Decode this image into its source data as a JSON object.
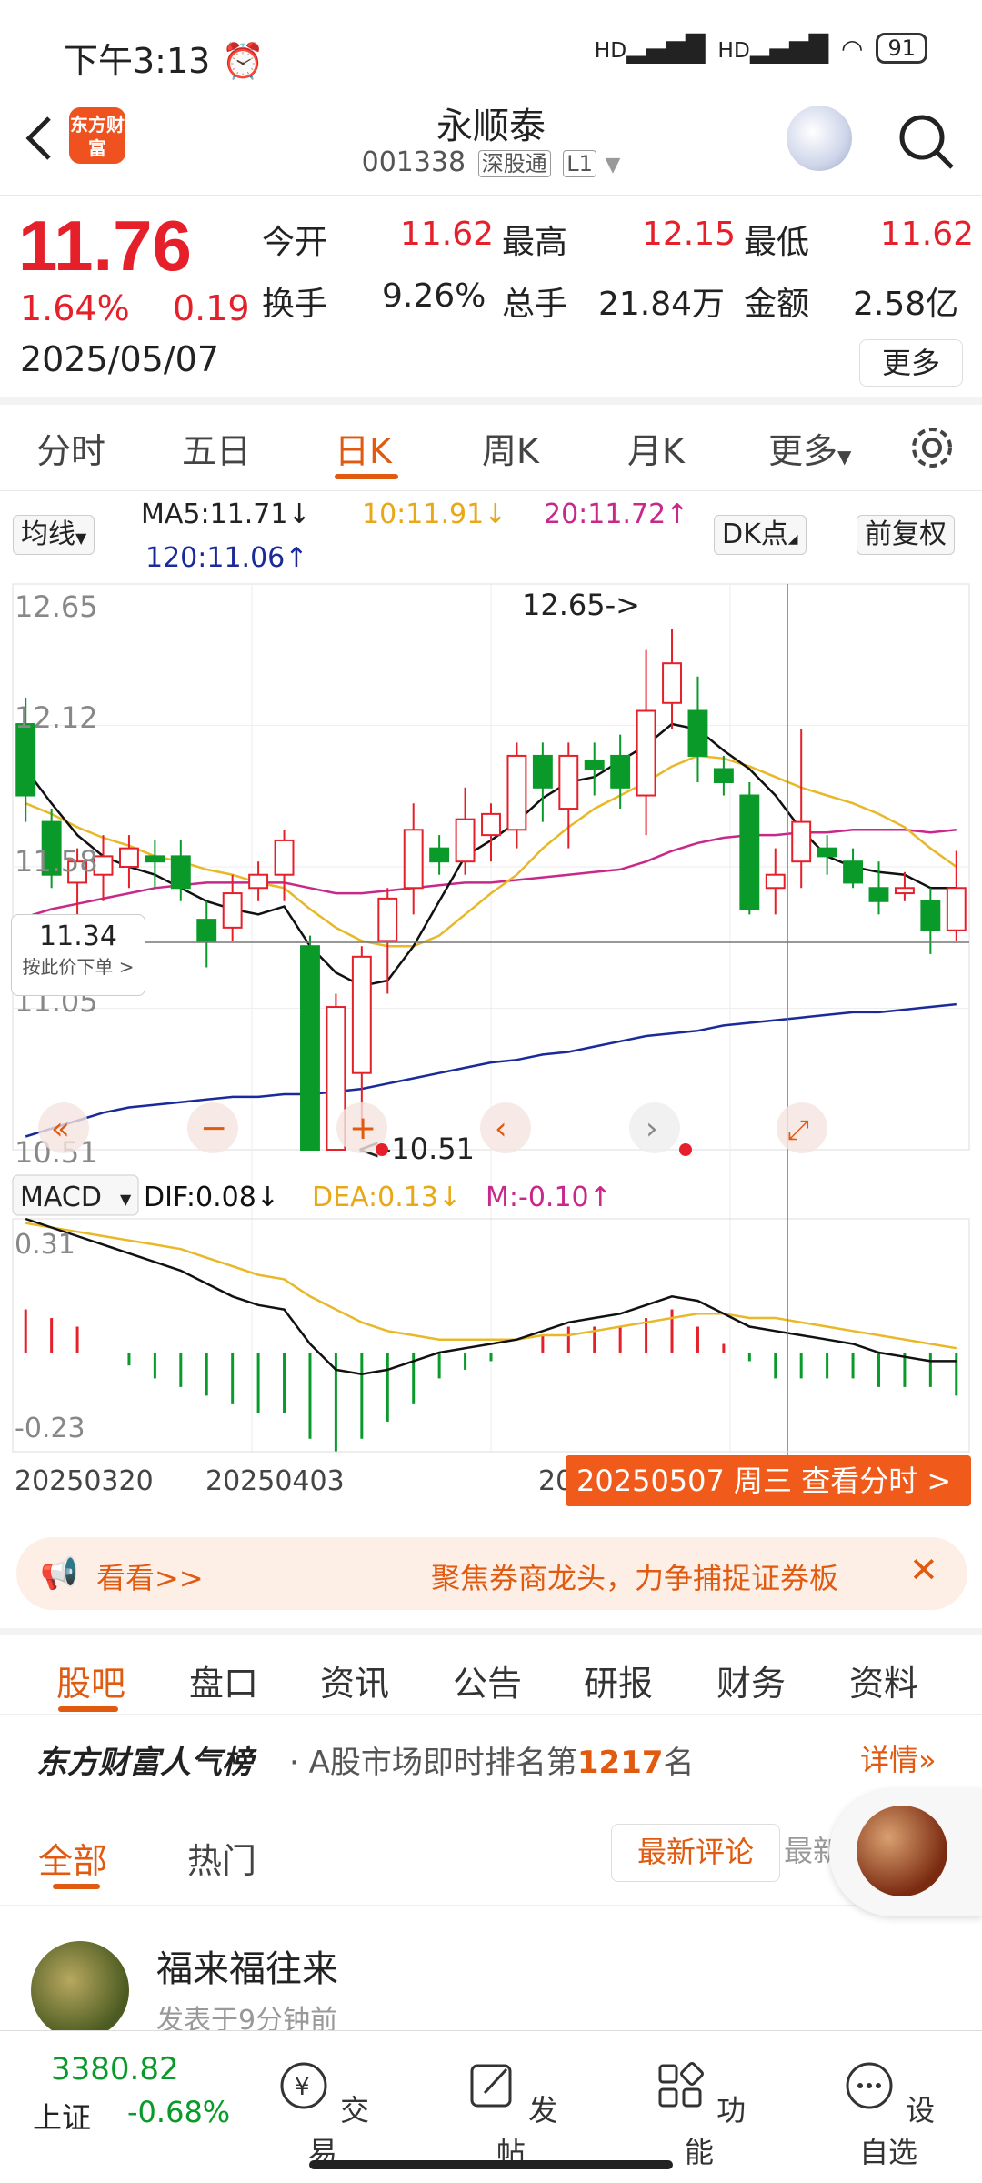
{
  "status_bar": {
    "time": "下午3:13",
    "alarm_icon": "alarm-icon",
    "network_1": "HD",
    "network_2": "HD",
    "battery": "91"
  },
  "header": {
    "logo_text": "东方财富",
    "stock_name": "永顺泰",
    "stock_code": "001338",
    "tag_1": "深股通",
    "tag_2": "L1"
  },
  "quote": {
    "price": "11.76",
    "change_pct": "1.64%",
    "change": "0.19",
    "date": "2025/05/07",
    "open_label": "今开",
    "open": "11.62",
    "high_label": "最高",
    "high": "12.15",
    "low_label": "最低",
    "low": "11.62",
    "turnover_label": "换手",
    "turnover": "9.26%",
    "volume_label": "总手",
    "volume": "21.84万",
    "amount_label": "金额",
    "amount": "2.58亿",
    "more": "更多"
  },
  "period_tabs": [
    "分时",
    "五日",
    "日K",
    "周K",
    "月K",
    "更多"
  ],
  "active_period": "日K",
  "legend": {
    "ma_button": "均线",
    "ma5": "MA5:11.71↓",
    "ma10": "10:11.91↓",
    "ma20": "20:11.72↑",
    "ma120": "120:11.06↑",
    "dk_button": "DK点",
    "adjust_button": "前复权"
  },
  "price_axis": {
    "top": "12.65",
    "l2": "12.12",
    "l3": "11.58",
    "l4": "11.05",
    "bottom": "10.51"
  },
  "annotations": {
    "high_marker": "12.65->",
    "low_marker": "<-10.51"
  },
  "price_tag": {
    "value": "11.34",
    "sub": "按此价下单 >"
  },
  "macd_legend": {
    "button": "MACD",
    "dif": "DIF:0.08↓",
    "dea": "DEA:0.13↓",
    "m": "M:-0.10↑"
  },
  "macd_axis": {
    "top": "0.31",
    "bottom": "-0.23"
  },
  "x_axis": {
    "d1": "20250320",
    "d2": "20250403",
    "d3": "20"
  },
  "view_time_btn": "20250507 周三 查看分时 >",
  "banner": {
    "left": "看看>>",
    "text": "聚焦券商龙头，力争捕捉证券板"
  },
  "content_tabs": [
    "股吧",
    "盘口",
    "资讯",
    "公告",
    "研报",
    "财务",
    "资料"
  ],
  "rank": {
    "brand": "东方财富人气榜",
    "prefix": "· A股市场即时排名第",
    "rank_no": "1217",
    "suffix": "名",
    "detail": "详情"
  },
  "sub_tabs": {
    "all": "全部",
    "hot": "热门",
    "latest": "最新评论",
    "latest2": "最新"
  },
  "post": {
    "user": "福来福往来",
    "time": "发表于9分钟前"
  },
  "bottom_nav": {
    "index_value": "3380.82",
    "index_name": "上证",
    "index_change": "-0.68%",
    "trade": "交易",
    "post": "发帖",
    "func": "功能",
    "watch": "设自选"
  },
  "colors": {
    "up": "#e5202a",
    "down": "#0a9a2a",
    "accent": "#e05a10",
    "ma5": "#111111",
    "ma10": "#e8b828",
    "ma20": "#c8288a",
    "ma120": "#1a2a9a"
  },
  "chart_data": {
    "type": "candlestick",
    "y_range": [
      10.51,
      12.65
    ],
    "candles": [
      {
        "o": 12.12,
        "c": 11.85,
        "h": 12.22,
        "l": 11.75
      },
      {
        "o": 11.75,
        "c": 11.55,
        "h": 11.8,
        "l": 11.5
      },
      {
        "o": 11.52,
        "c": 11.6,
        "h": 11.65,
        "l": 11.4
      },
      {
        "o": 11.55,
        "c": 11.62,
        "h": 11.7,
        "l": 11.45
      },
      {
        "o": 11.58,
        "c": 11.65,
        "h": 11.7,
        "l": 11.5
      },
      {
        "o": 11.62,
        "c": 11.6,
        "h": 11.68,
        "l": 11.5
      },
      {
        "o": 11.62,
        "c": 11.5,
        "h": 11.68,
        "l": 11.45
      },
      {
        "o": 11.38,
        "c": 11.3,
        "h": 11.45,
        "l": 11.2
      },
      {
        "o": 11.35,
        "c": 11.48,
        "h": 11.55,
        "l": 11.3
      },
      {
        "o": 11.5,
        "c": 11.55,
        "h": 11.6,
        "l": 11.45
      },
      {
        "o": 11.55,
        "c": 11.68,
        "h": 11.72,
        "l": 11.45
      },
      {
        "o": 11.28,
        "c": 10.51,
        "h": 11.32,
        "l": 10.51
      },
      {
        "o": 10.51,
        "c": 11.05,
        "h": 11.1,
        "l": 10.51
      },
      {
        "o": 10.8,
        "c": 11.24,
        "h": 11.28,
        "l": 10.6
      },
      {
        "o": 11.3,
        "c": 11.46,
        "h": 11.5,
        "l": 11.1
      },
      {
        "o": 11.5,
        "c": 11.72,
        "h": 11.82,
        "l": 11.4
      },
      {
        "o": 11.65,
        "c": 11.6,
        "h": 11.7,
        "l": 11.55
      },
      {
        "o": 11.6,
        "c": 11.76,
        "h": 11.88,
        "l": 11.55
      },
      {
        "o": 11.7,
        "c": 11.78,
        "h": 11.82,
        "l": 11.6
      },
      {
        "o": 11.72,
        "c": 12.0,
        "h": 12.05,
        "l": 11.65
      },
      {
        "o": 12.0,
        "c": 11.88,
        "h": 12.05,
        "l": 11.75
      },
      {
        "o": 11.8,
        "c": 12.0,
        "h": 12.05,
        "l": 11.65
      },
      {
        "o": 11.98,
        "c": 11.95,
        "h": 12.05,
        "l": 11.85
      },
      {
        "o": 12.0,
        "c": 11.88,
        "h": 12.08,
        "l": 11.8
      },
      {
        "o": 11.85,
        "c": 12.17,
        "h": 12.4,
        "l": 11.7
      },
      {
        "o": 12.2,
        "c": 12.35,
        "h": 12.48,
        "l": 12.1
      },
      {
        "o": 12.17,
        "c": 12.0,
        "h": 12.3,
        "l": 11.9
      },
      {
        "o": 11.95,
        "c": 11.9,
        "h": 12.0,
        "l": 11.85
      },
      {
        "o": 11.85,
        "c": 11.42,
        "h": 11.9,
        "l": 11.4
      },
      {
        "o": 11.5,
        "c": 11.55,
        "h": 11.65,
        "l": 11.4
      },
      {
        "o": 11.6,
        "c": 11.75,
        "h": 12.1,
        "l": 11.5
      },
      {
        "o": 11.65,
        "c": 11.62,
        "h": 11.7,
        "l": 11.55
      },
      {
        "o": 11.6,
        "c": 11.52,
        "h": 11.65,
        "l": 11.5
      },
      {
        "o": 11.5,
        "c": 11.45,
        "h": 11.6,
        "l": 11.4
      },
      {
        "o": 11.48,
        "c": 11.5,
        "h": 11.56,
        "l": 11.45
      },
      {
        "o": 11.45,
        "c": 11.34,
        "h": 11.5,
        "l": 11.25
      },
      {
        "o": 11.34,
        "c": 11.5,
        "h": 11.64,
        "l": 11.3
      }
    ],
    "ma5": [
      11.95,
      11.82,
      11.7,
      11.62,
      11.58,
      11.55,
      11.5,
      11.45,
      11.42,
      11.4,
      11.43,
      11.28,
      11.18,
      11.13,
      11.15,
      11.28,
      11.45,
      11.62,
      11.68,
      11.75,
      11.84,
      11.9,
      11.92,
      11.98,
      12.04,
      12.12,
      12.1,
      12.02,
      11.95,
      11.85,
      11.72,
      11.62,
      11.58,
      11.56,
      11.55,
      11.5,
      11.5
    ],
    "ma10": [
      11.82,
      11.78,
      11.73,
      11.69,
      11.66,
      11.62,
      11.6,
      11.57,
      11.55,
      11.52,
      11.5,
      11.42,
      11.35,
      11.3,
      11.28,
      11.28,
      11.32,
      11.4,
      11.48,
      11.55,
      11.65,
      11.73,
      11.8,
      11.85,
      11.9,
      11.96,
      12.0,
      11.99,
      11.96,
      11.92,
      11.88,
      11.85,
      11.82,
      11.78,
      11.73,
      11.65,
      11.58
    ],
    "ma20": [
      11.39,
      11.42,
      11.44,
      11.46,
      11.48,
      11.5,
      11.51,
      11.52,
      11.52,
      11.52,
      11.52,
      11.5,
      11.48,
      11.48,
      11.49,
      11.5,
      11.51,
      11.52,
      11.52,
      11.53,
      11.54,
      11.55,
      11.56,
      11.57,
      11.6,
      11.64,
      11.67,
      11.69,
      11.7,
      11.7,
      11.71,
      11.71,
      11.72,
      11.72,
      11.72,
      11.71,
      11.72
    ],
    "ma120": [
      10.56,
      10.59,
      10.62,
      10.65,
      10.67,
      10.68,
      10.69,
      10.7,
      10.71,
      10.71,
      10.72,
      10.72,
      10.73,
      10.74,
      10.76,
      10.78,
      10.8,
      10.82,
      10.84,
      10.85,
      10.87,
      10.88,
      10.9,
      10.92,
      10.94,
      10.95,
      10.96,
      10.98,
      10.99,
      11.0,
      11.01,
      11.02,
      11.03,
      11.03,
      11.04,
      11.05,
      11.06
    ],
    "macd": {
      "y_range": [
        -0.23,
        0.31
      ],
      "dif": [
        0.31,
        0.29,
        0.27,
        0.25,
        0.23,
        0.21,
        0.19,
        0.16,
        0.13,
        0.11,
        0.1,
        0.02,
        -0.04,
        -0.05,
        -0.04,
        -0.02,
        0.0,
        0.01,
        0.02,
        0.03,
        0.05,
        0.07,
        0.08,
        0.09,
        0.11,
        0.13,
        0.12,
        0.09,
        0.06,
        0.05,
        0.04,
        0.03,
        0.02,
        0.0,
        -0.01,
        -0.02,
        -0.02
      ],
      "dea": [
        0.3,
        0.29,
        0.28,
        0.27,
        0.26,
        0.25,
        0.24,
        0.22,
        0.2,
        0.18,
        0.17,
        0.13,
        0.1,
        0.07,
        0.05,
        0.04,
        0.03,
        0.03,
        0.03,
        0.03,
        0.04,
        0.04,
        0.05,
        0.06,
        0.07,
        0.08,
        0.09,
        0.09,
        0.08,
        0.08,
        0.07,
        0.06,
        0.05,
        0.04,
        0.03,
        0.02,
        0.01
      ],
      "m": [
        0.1,
        0.08,
        0.06,
        0.0,
        -0.03,
        -0.06,
        -0.08,
        -0.1,
        -0.12,
        -0.14,
        -0.14,
        -0.2,
        -0.23,
        -0.2,
        -0.16,
        -0.12,
        -0.06,
        -0.04,
        -0.02,
        0.0,
        0.04,
        0.06,
        0.06,
        0.06,
        0.08,
        0.1,
        0.06,
        0.02,
        -0.02,
        -0.06,
        -0.06,
        -0.06,
        -0.06,
        -0.08,
        -0.08,
        -0.08,
        -0.1
      ]
    }
  }
}
